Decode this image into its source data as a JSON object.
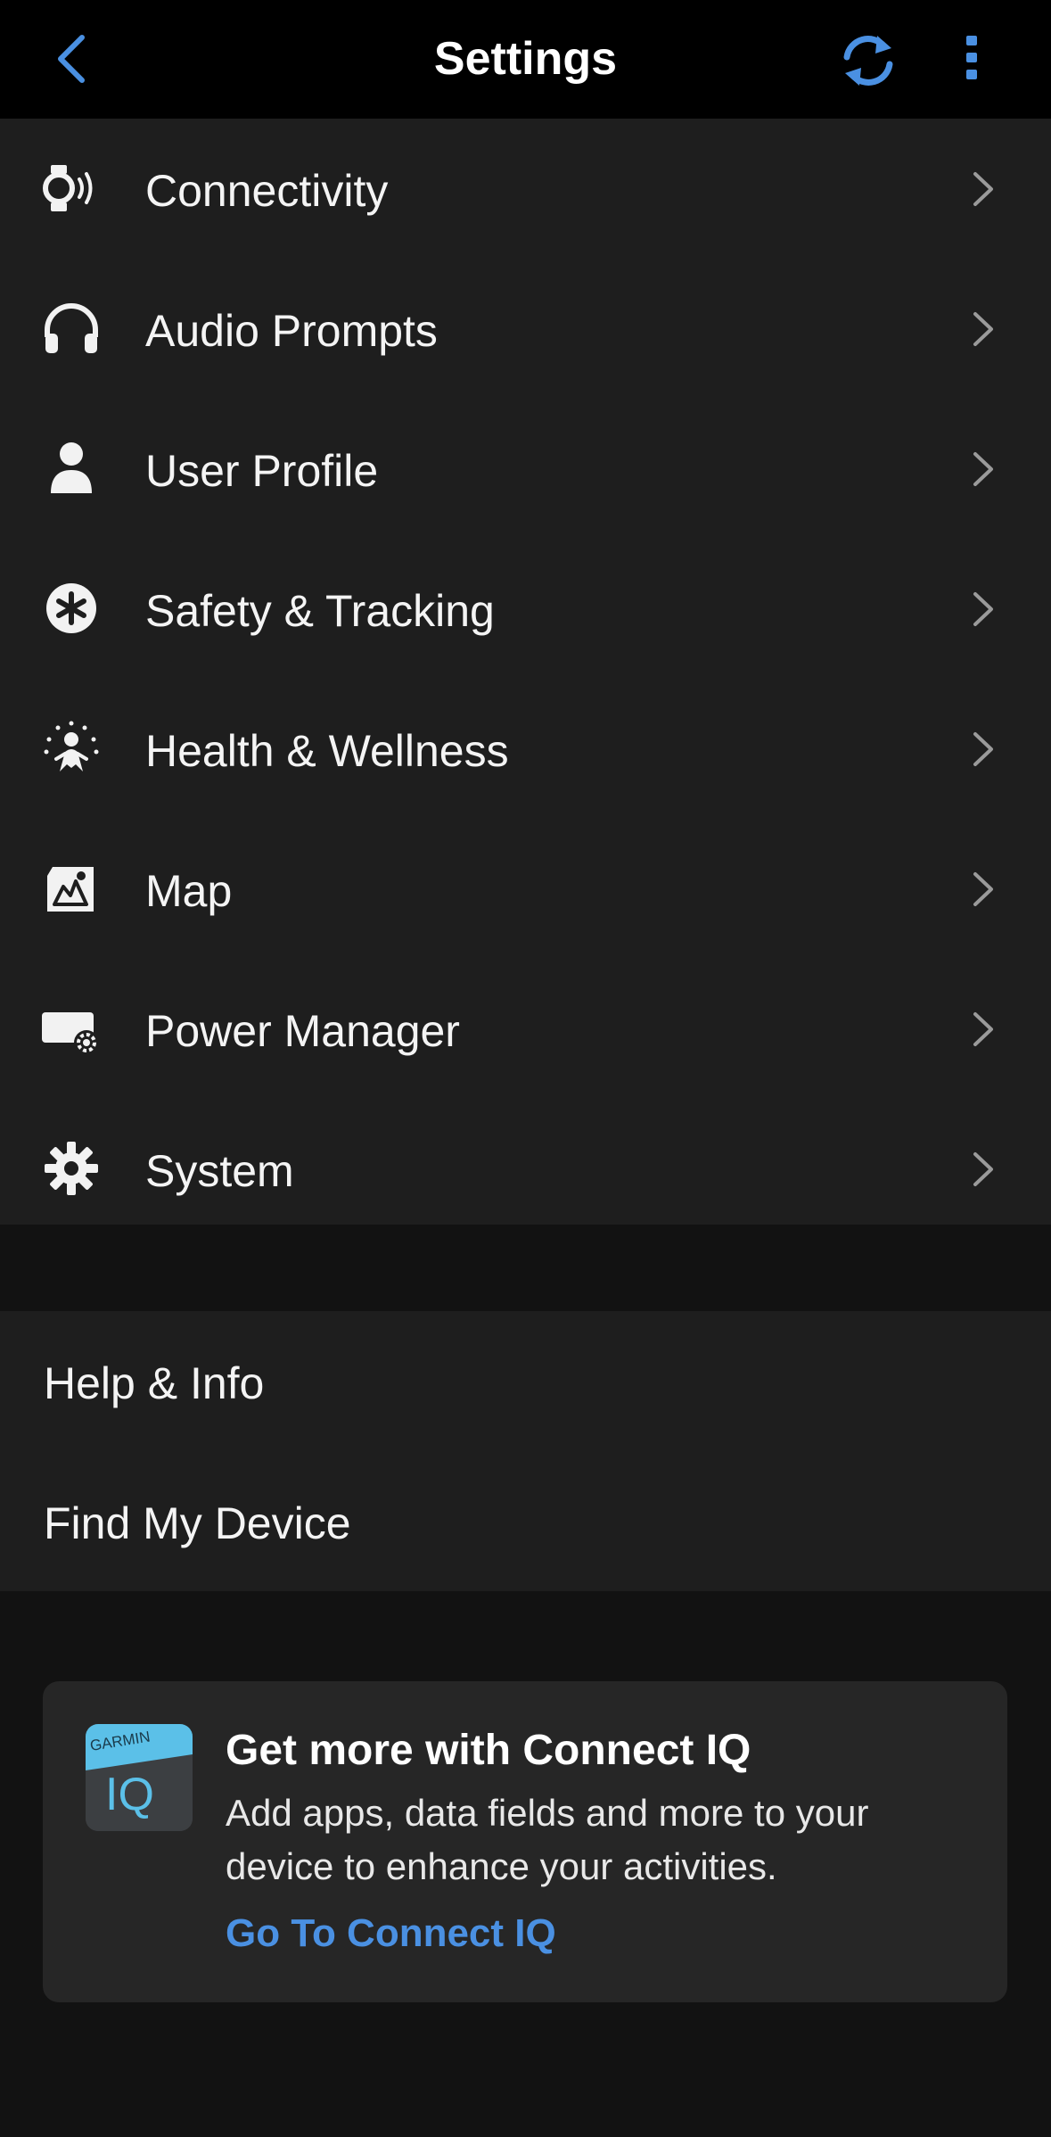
{
  "header": {
    "title": "Settings",
    "back_icon": "chevron-left-icon",
    "sync_icon": "sync-icon",
    "more_icon": "more-vertical-icon",
    "accent_color": "#4a90e2"
  },
  "menu": {
    "items": [
      {
        "label": "Connectivity",
        "icon": "watch-signal-icon"
      },
      {
        "label": "Audio Prompts",
        "icon": "headphones-icon"
      },
      {
        "label": "User Profile",
        "icon": "person-icon"
      },
      {
        "label": "Safety & Tracking",
        "icon": "safety-asterisk-icon"
      },
      {
        "label": "Health & Wellness",
        "icon": "wellness-person-icon"
      },
      {
        "label": "Map",
        "icon": "map-icon"
      },
      {
        "label": "Power Manager",
        "icon": "battery-gear-icon"
      },
      {
        "label": "System",
        "icon": "gear-icon"
      }
    ]
  },
  "secondary": {
    "items": [
      {
        "label": "Help & Info"
      },
      {
        "label": "Find My Device"
      }
    ]
  },
  "connect_iq": {
    "logo_brand": "GARMIN",
    "logo_text": "IQ",
    "title": "Get more with Connect IQ",
    "description": "Add apps, data fields and more to your device to enhance your activities.",
    "link": "Go To Connect IQ"
  }
}
